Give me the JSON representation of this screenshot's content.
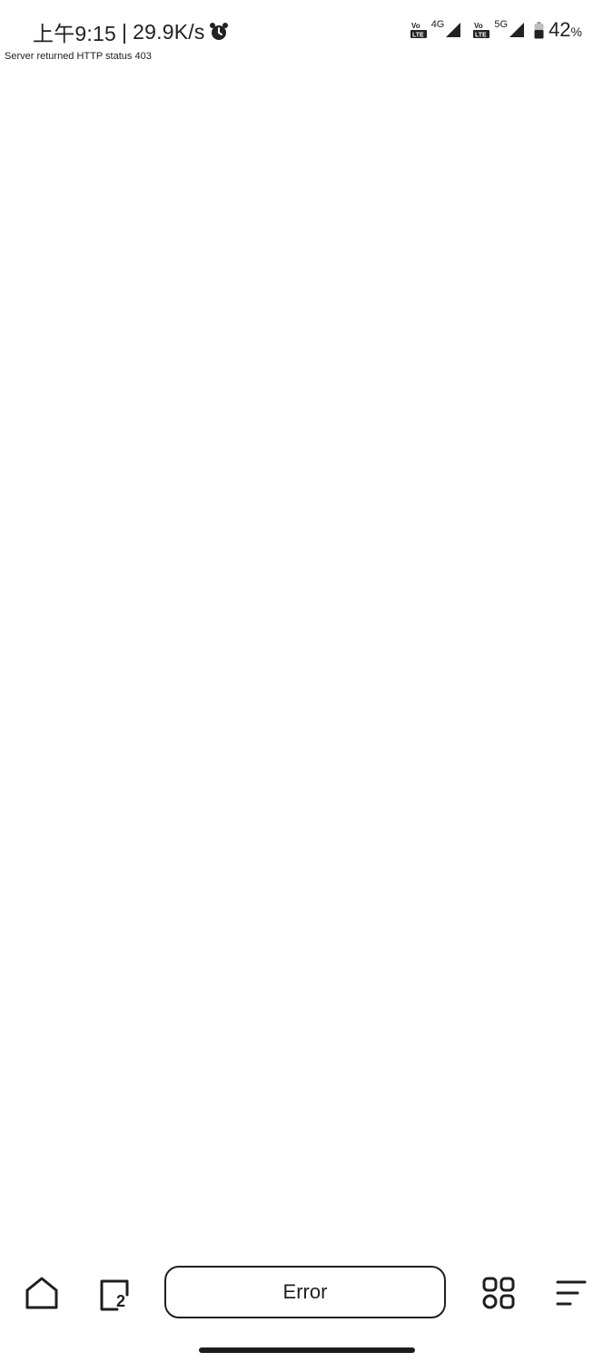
{
  "status_bar": {
    "time": "上午9:15",
    "separator": "|",
    "net_speed": "29.9K/s",
    "sim1_network": "4G",
    "sim2_network": "5G",
    "battery_level": "42",
    "battery_unit": "%",
    "icons": {
      "alarm": "alarm-clock-icon",
      "volte": "volte-lte-icon",
      "signal": "cellular-signal-icon",
      "battery": "battery-icon"
    }
  },
  "content": {
    "error_message": "Server returned HTTP status 403"
  },
  "toolbar": {
    "address_label": "Error",
    "tab_count": "2",
    "icons": {
      "home": "home-icon",
      "tabs": "tabs-icon",
      "apps": "apps-grid-icon",
      "menu": "menu-lines-icon"
    }
  },
  "colors": {
    "background": "#ffffff",
    "foreground": "#1f1f1f"
  }
}
